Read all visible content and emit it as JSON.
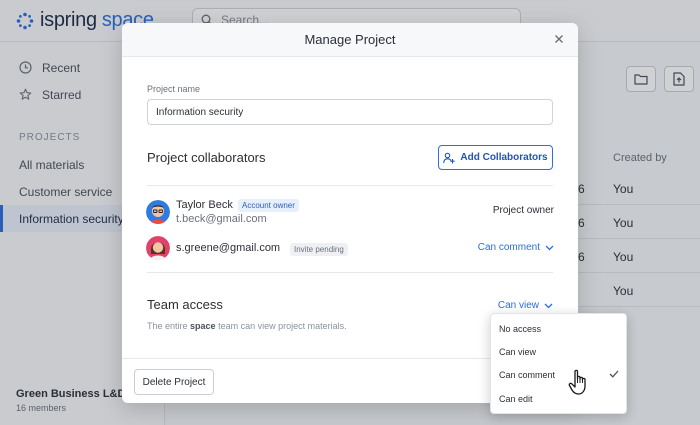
{
  "app": {
    "logo_word": "ispring",
    "logo_space": "space",
    "search_placeholder": "Search...",
    "sidebar": {
      "recent": "Recent",
      "starred": "Starred",
      "projects_heading": "PROJECTS",
      "items": [
        {
          "label": "All materials"
        },
        {
          "label": "Customer service"
        },
        {
          "label": "Information security"
        }
      ],
      "workspace_name": "Green Business L&D",
      "workspace_members": "16 members"
    },
    "table": {
      "created_by_header": "Created by",
      "rows": [
        {
          "date": "6",
          "by": "You"
        },
        {
          "date": "6",
          "by": "You"
        },
        {
          "date": "6",
          "by": "You"
        },
        {
          "date": "",
          "by": "You"
        }
      ]
    }
  },
  "modal": {
    "title": "Manage Project",
    "project_name_label": "Project name",
    "project_name_value": "Information security",
    "collaborators_title": "Project collaborators",
    "add_collaborators_label": "Add Collaborators",
    "collaborators": [
      {
        "name": "Taylor Beck",
        "badge": "Account owner",
        "email": "t.beck@gmail.com",
        "role": "Project owner"
      },
      {
        "email": "s.greene@gmail.com",
        "badge": "Invite pending",
        "role": "Can comment"
      }
    ],
    "team_access_title": "Team access",
    "team_access_value": "Can view",
    "team_desc_prefix": "The entire ",
    "team_desc_space": "space",
    "team_desc_suffix": " team can view project materials.",
    "delete_label": "Delete Project"
  },
  "access_menu": {
    "options": [
      "No access",
      "Can view",
      "Can comment",
      "Can edit"
    ],
    "checked": "Can comment"
  },
  "colors": {
    "accent": "#2b6fdc",
    "badge_owner_bg": "#e7effc"
  }
}
